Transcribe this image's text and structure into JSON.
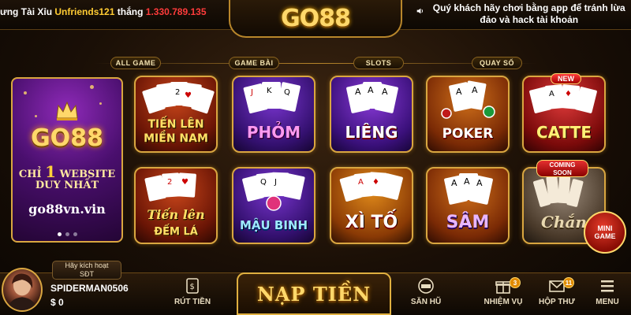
{
  "top": {
    "ticker": {
      "prefix": "ưng Tài Xỉu",
      "user": "Unfriends121",
      "verb": "thắng",
      "amount": "1.330.789.135"
    },
    "logo": "GO88",
    "notice": "Quý khách hãy chơi bằng app để tránh lừa đảo và hack tài khoản"
  },
  "categories": [
    "ALL GAME",
    "GAME BÀI",
    "SLOTS",
    "QUAY SỐ"
  ],
  "promo": {
    "logo": "GO88",
    "tag_prefix": "CHỈ",
    "tag_number": "1",
    "tag_suffix": "WEBSITE",
    "tag_line2": "DUY NHẤT",
    "url": "go88vn.vin",
    "slide_count": 3,
    "active_slide": 1
  },
  "games": {
    "row1": [
      {
        "label_line1": "TIẾN LÊN",
        "label_line2": "MIỀN NAM"
      },
      {
        "label_line1": "PHỎM",
        "label_line2": ""
      },
      {
        "label_line1": "LIÊNG",
        "label_line2": ""
      },
      {
        "label_line1": "POKER",
        "label_line2": ""
      },
      {
        "label_line1": "CATTE",
        "label_line2": "",
        "badge": "NEW"
      }
    ],
    "row2": [
      {
        "label_line1": "Tiến lên",
        "label_line2": "ĐẾM LÁ"
      },
      {
        "label_line1": "MẬU BINH",
        "label_line2": ""
      },
      {
        "label_line1": "XÌ TỐ",
        "label_line2": ""
      },
      {
        "label_line1": "SÂM",
        "label_line2": ""
      },
      {
        "label_line1": "Chắn",
        "label_line2": "",
        "badge_line1": "COMING",
        "badge_line2": "SOON"
      }
    ]
  },
  "mini_game": {
    "line1": "MINI",
    "line2": "GAME"
  },
  "bottom": {
    "activate_line1": "Hãy kích hoạt",
    "activate_line2": "SĐT",
    "username": "SPIDERMAN0506",
    "balance": "$ 0",
    "withdraw": "RÚT TIỀN",
    "deposit": "NẠP TIỀN",
    "jackpot": "SĂN HŨ",
    "missions": "NHIỆM VỤ",
    "missions_count": "3",
    "inbox": "HỘP THƯ",
    "inbox_count": "11",
    "menu": "MENU"
  },
  "colors": {
    "gold": "#d9a640",
    "accent_red": "#ff3b3b",
    "ticker_user": "#ffcc33"
  }
}
